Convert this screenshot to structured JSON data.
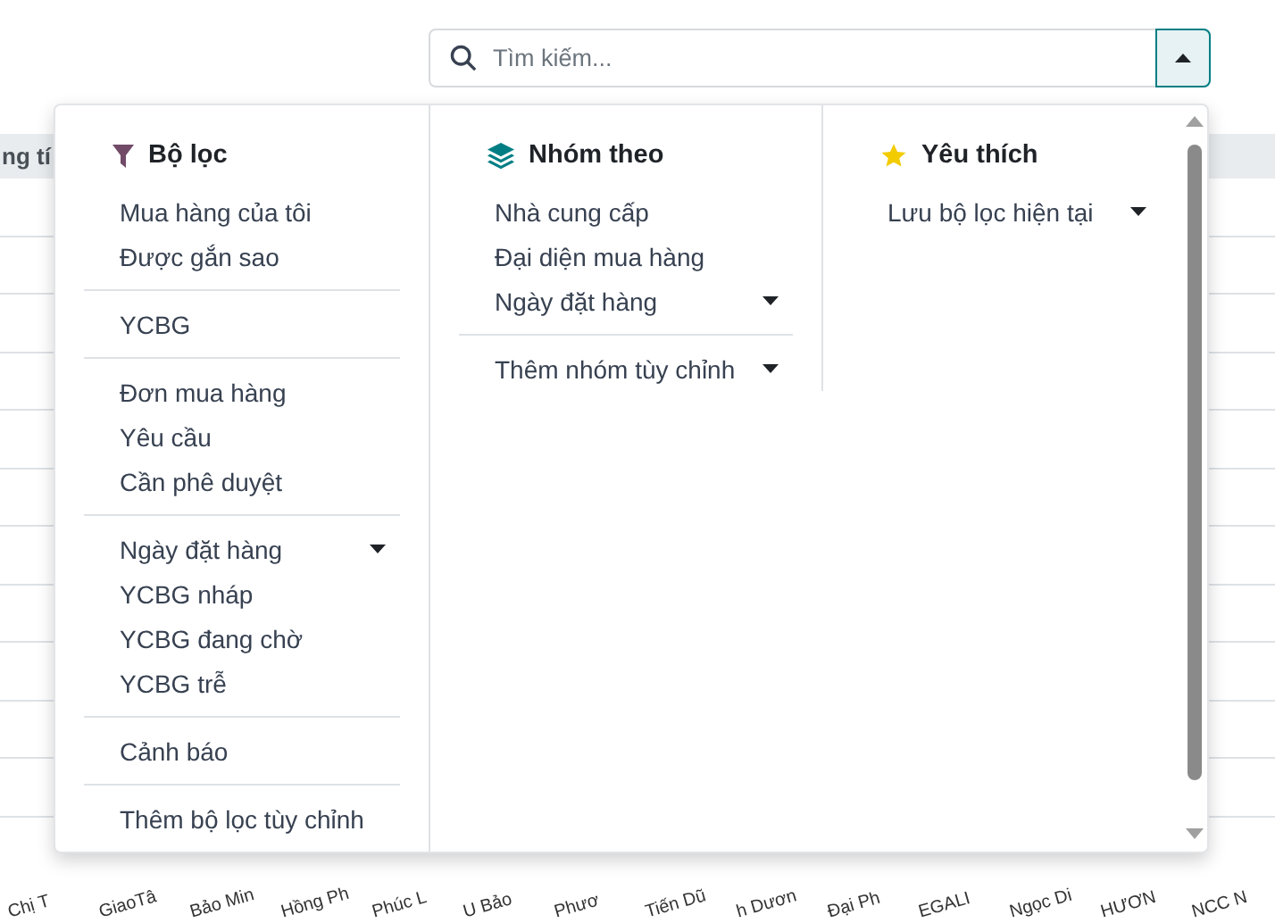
{
  "search": {
    "placeholder": "Tìm kiếm...",
    "expanded": true
  },
  "background": {
    "header_text": "ng tí",
    "axis_labels": [
      "Chị T",
      "GiaoTâ",
      "Bảo Min",
      "Hồng Ph",
      "Phúc L",
      "U Bảo",
      "Phươ",
      "Tiến Dũ",
      "h Dươn",
      "Đại Ph",
      "EGALI",
      "Ngọc Di",
      "HƯƠN",
      "NCC N"
    ]
  },
  "panel": {
    "columns": [
      {
        "kind": "filter",
        "title": "Bộ lọc",
        "groups": [
          [
            {
              "label": "Mua hàng của tôi",
              "kind": "option"
            },
            {
              "label": "Được gắn sao",
              "kind": "option"
            }
          ],
          [
            {
              "label": "YCBG",
              "kind": "option"
            }
          ],
          [
            {
              "label": "Đơn mua hàng",
              "kind": "option"
            },
            {
              "label": "Yêu cầu",
              "kind": "option"
            },
            {
              "label": "Cần phê duyệt",
              "kind": "option"
            }
          ],
          [
            {
              "label": "Ngày đặt hàng",
              "kind": "dropdown"
            },
            {
              "label": "YCBG nháp",
              "kind": "option"
            },
            {
              "label": "YCBG đang chờ",
              "kind": "option"
            },
            {
              "label": "YCBG trễ",
              "kind": "option"
            }
          ],
          [
            {
              "label": "Cảnh báo",
              "kind": "option"
            }
          ],
          [
            {
              "label": "Thêm bộ lọc tùy chỉnh",
              "kind": "option"
            }
          ]
        ]
      },
      {
        "kind": "group",
        "title": "Nhóm theo",
        "groups": [
          [
            {
              "label": "Nhà cung cấp",
              "kind": "option"
            },
            {
              "label": "Đại diện mua hàng",
              "kind": "option"
            },
            {
              "label": "Ngày đặt hàng",
              "kind": "dropdown"
            }
          ],
          [
            {
              "label": "Thêm nhóm tùy chỉnh",
              "kind": "dropdown"
            }
          ]
        ]
      },
      {
        "kind": "favorite",
        "title": "Yêu thích",
        "groups": [
          [
            {
              "label": "Lưu bộ lọc hiện tại",
              "kind": "dropdown"
            }
          ]
        ]
      }
    ]
  }
}
